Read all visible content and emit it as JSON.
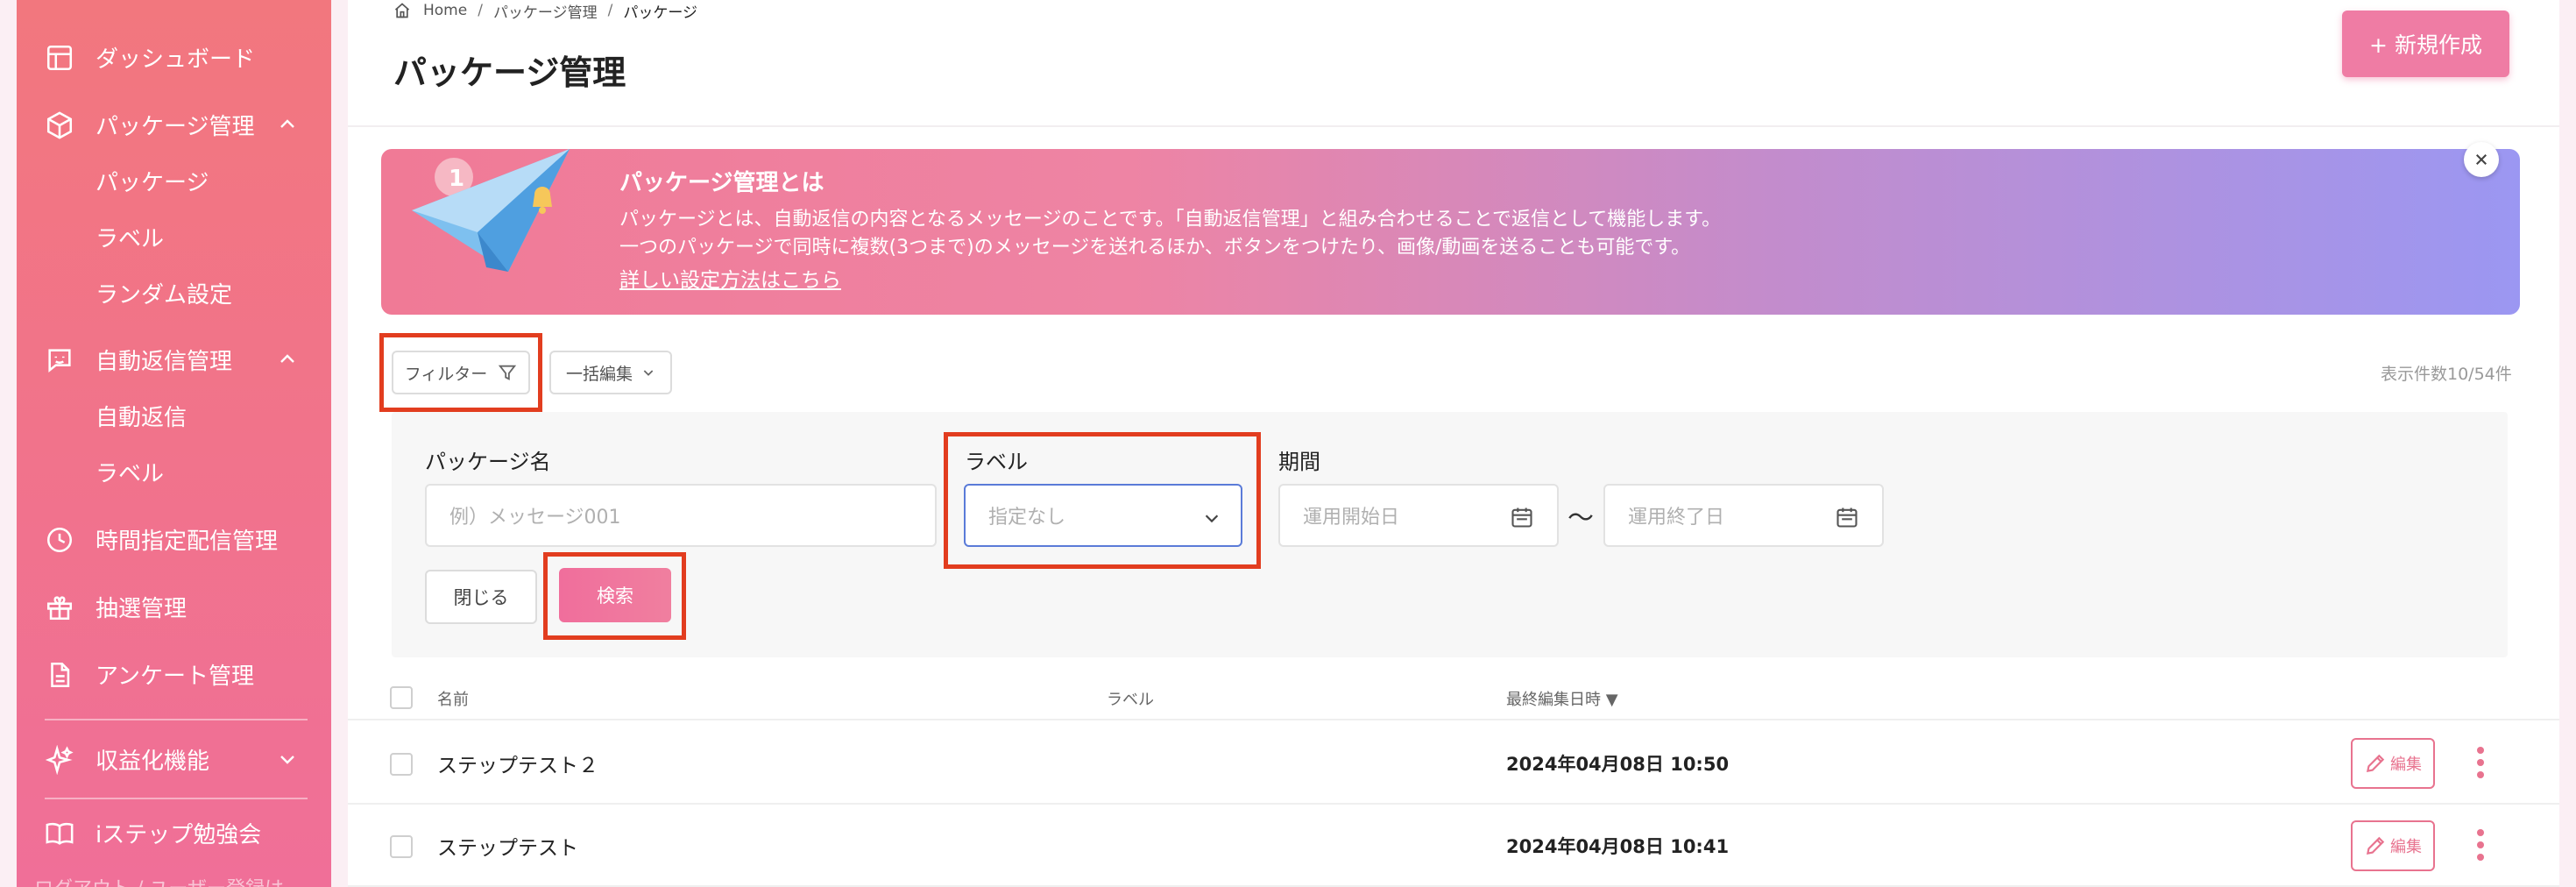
{
  "sidebar": {
    "items": [
      {
        "label": "ダッシュボード",
        "icon": "dashboard-icon"
      },
      {
        "label": "パッケージ管理",
        "icon": "package-icon",
        "expanded": true,
        "children": [
          "パッケージ",
          "ラベル",
          "ランダム設定"
        ]
      },
      {
        "label": "自動返信管理",
        "icon": "chat-icon",
        "expanded": true,
        "children": [
          "自動返信",
          "ラベル"
        ]
      },
      {
        "label": "時間指定配信管理",
        "icon": "clock-icon"
      },
      {
        "label": "抽選管理",
        "icon": "gift-icon"
      },
      {
        "label": "アンケート管理",
        "icon": "document-icon"
      },
      {
        "label": "収益化機能",
        "icon": "sparkle-icon",
        "expanded": false
      },
      {
        "label": "iステップ勉強会",
        "icon": "book-icon"
      }
    ],
    "fade_text": "ログアウト / ユーザー登録は"
  },
  "breadcrumb": {
    "home": "Home",
    "parent": "パッケージ管理",
    "current": "パッケージ"
  },
  "page_title": "パッケージ管理",
  "new_button": "+ 新規作成",
  "banner": {
    "title": "パッケージ管理とは",
    "line1": "パッケージとは、自動返信の内容となるメッセージのことです。「自動返信管理」と組み合わせることで返信として機能します。",
    "line2": "一つのパッケージで同時に複数(3つまで)のメッセージを送れるほか、ボタンをつけたり、画像/動画を送ることも可能です。",
    "link": "詳しい設定方法はこちら",
    "badge": "1"
  },
  "toolbar": {
    "filter": "フィルター",
    "bulk_edit": "一括編集",
    "count": "表示件数10/54件"
  },
  "filter": {
    "name_label": "パッケージ名",
    "name_placeholder": "例）メッセージ001",
    "label_label": "ラベル",
    "label_value": "指定なし",
    "period_label": "期間",
    "start_placeholder": "運用開始日",
    "tilde": "〜",
    "end_placeholder": "運用終了日",
    "close": "閉じる",
    "search": "検索"
  },
  "table": {
    "headers": {
      "name": "名前",
      "label": "ラベル",
      "updated": "最終編集日時 ▼"
    },
    "rows": [
      {
        "name": "ステップテスト２",
        "label": "",
        "updated": "2024年04月08日 10:50"
      },
      {
        "name": "ステップテスト",
        "label": "",
        "updated": "2024年04月08日 10:41"
      }
    ],
    "edit_label": "編集"
  },
  "colors": {
    "accent": "#ef7ca4",
    "highlight": "#e23d1f",
    "select_border": "#5a7bd8"
  }
}
